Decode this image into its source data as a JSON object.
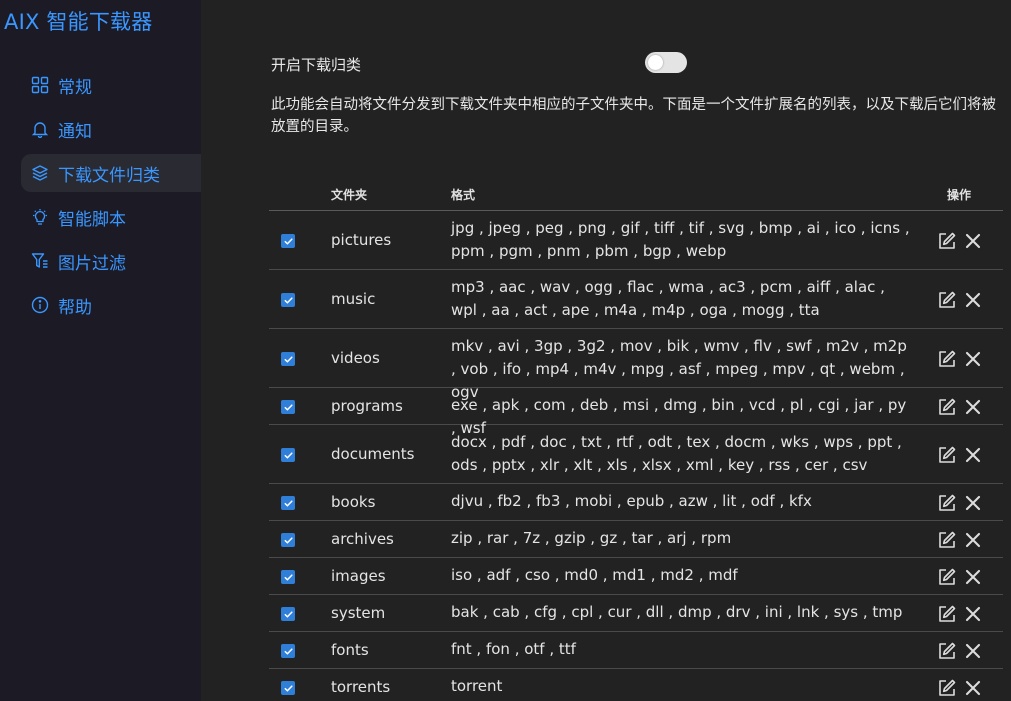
{
  "app": {
    "title": "AIX 智能下载器"
  },
  "sidebar": {
    "items": [
      {
        "label": "常规",
        "icon": "grid-icon",
        "active": false
      },
      {
        "label": "通知",
        "icon": "bell-icon",
        "active": false
      },
      {
        "label": "下载文件归类",
        "icon": "layers-icon",
        "active": true
      },
      {
        "label": "智能脚本",
        "icon": "lightbulb-icon",
        "active": false
      },
      {
        "label": "图片过滤",
        "icon": "filter-icon",
        "active": false
      },
      {
        "label": "帮助",
        "icon": "info-icon",
        "active": false
      }
    ]
  },
  "main": {
    "toggle_label": "开启下载归类",
    "toggle_on": false,
    "description": "此功能会自动将文件分发到下载文件夹中相应的子文件夹中。下面是一个文件扩展名的列表，以及下载后它们将被放置的目录。",
    "table": {
      "headers": {
        "folder": "文件夹",
        "format": "格式",
        "actions": "操作"
      },
      "rows": [
        {
          "checked": true,
          "folder": "pictures",
          "formats": "jpg , jpeg , peg , png , gif , tiff , tif , svg , bmp , ai , ico , icns , ppm , pgm , pnm , pbm , bgp , webp"
        },
        {
          "checked": true,
          "folder": "music",
          "formats": "mp3 , aac , wav , ogg , flac , wma , ac3 , pcm , aiff , alac , wpl , aa , act , ape , m4a , m4p , oga , mogg , tta"
        },
        {
          "checked": true,
          "folder": "videos",
          "formats": "mkv , avi , 3gp , 3g2 , mov , bik , wmv , flv , swf , m2v , m2p , vob , ifo , mp4 , m4v , mpg , asf , mpeg , mpv , qt , webm , ogv"
        },
        {
          "checked": true,
          "folder": "programs",
          "formats": "exe , apk , com , deb , msi , dmg , bin , vcd , pl , cgi , jar , py , wsf"
        },
        {
          "checked": true,
          "folder": "documents",
          "formats": "docx , pdf , doc , txt , rtf , odt , tex , docm , wks , wps , ppt , ods , pptx , xlr , xlt , xls , xlsx , xml , key , rss , cer , csv"
        },
        {
          "checked": true,
          "folder": "books",
          "formats": "djvu , fb2 , fb3 , mobi , epub , azw , lit , odf , kfx"
        },
        {
          "checked": true,
          "folder": "archives",
          "formats": "zip , rar , 7z , gzip , gz , tar , arj , rpm"
        },
        {
          "checked": true,
          "folder": "images",
          "formats": "iso , adf , cso , md0 , md1 , md2 , mdf"
        },
        {
          "checked": true,
          "folder": "system",
          "formats": "bak , cab , cfg , cpl , cur , dll , dmp , drv , ini , lnk , sys , tmp"
        },
        {
          "checked": true,
          "folder": "fonts",
          "formats": "fnt , fon , otf , ttf"
        },
        {
          "checked": true,
          "folder": "torrents",
          "formats": "torrent"
        }
      ]
    }
  },
  "colors": {
    "accent": "#3a97ff",
    "sidebar_bg": "#1b1a25",
    "main_bg": "#222222",
    "checkbox": "#2f7fd9"
  }
}
